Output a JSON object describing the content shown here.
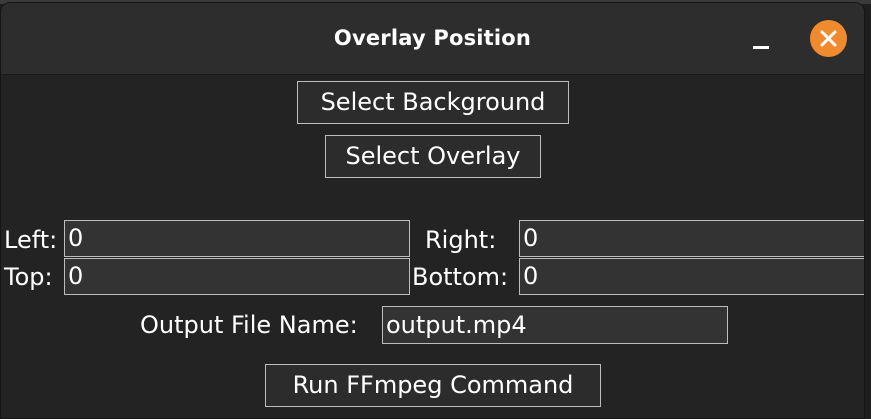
{
  "window": {
    "title": "Overlay Position"
  },
  "buttons": {
    "select_background": "Select Background",
    "select_overlay": "Select Overlay",
    "run": "Run FFmpeg Command"
  },
  "fields": {
    "left": {
      "label": "Left:",
      "value": "0"
    },
    "right": {
      "label": "Right:",
      "value": "0"
    },
    "top": {
      "label": "Top:",
      "value": "0"
    },
    "bottom": {
      "label": "Bottom:",
      "value": "0"
    },
    "output": {
      "label": "Output File Name:",
      "value": "output.mp4"
    }
  },
  "colors": {
    "close_button": "#f08a2e",
    "background": "#232323",
    "titlebar": "#2d2d2d"
  },
  "icons": {
    "minimize": "minimize-icon",
    "close": "close-icon"
  }
}
